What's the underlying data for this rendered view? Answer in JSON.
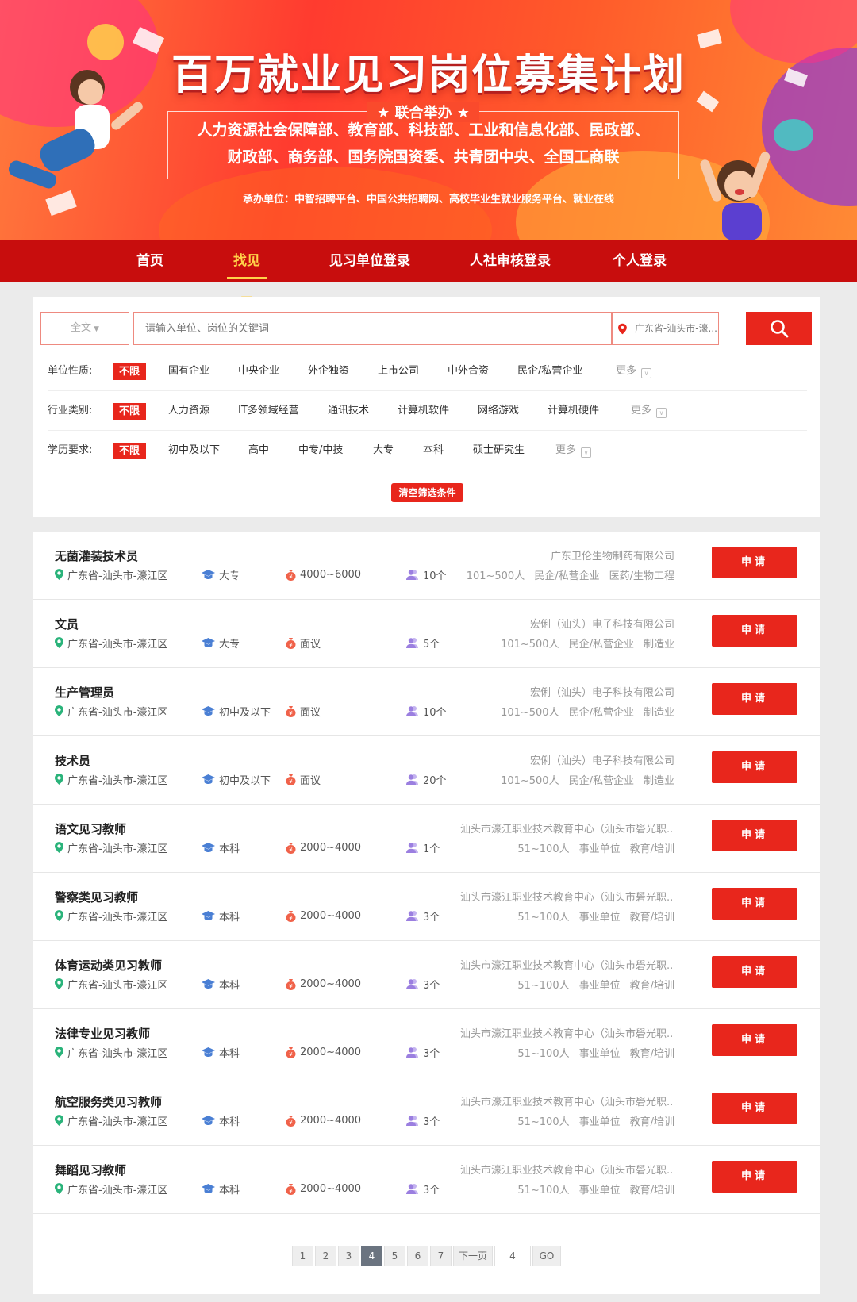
{
  "banner": {
    "title": "百万就业见习岗位募集计划",
    "joint_label": "★ 联合举办 ★",
    "orgs_line1": "人力资源社会保障部、教育部、科技部、工业和信息化部、民政部、",
    "orgs_line2": "财政部、商务部、国务院国资委、共青团中央、全国工商联",
    "undertake": "承办单位：中智招聘平台、中国公共招聘网、高校毕业生就业服务平台、就业在线"
  },
  "nav": {
    "items": [
      {
        "label": "首页",
        "active": false
      },
      {
        "label": "找见习",
        "active": true
      },
      {
        "label": "见习单位登录",
        "active": false
      },
      {
        "label": "人社审核登录",
        "active": false
      },
      {
        "label": "个人登录",
        "active": false
      }
    ]
  },
  "search": {
    "scope_label": "全文",
    "keyword_placeholder": "请输入单位、岗位的关键词",
    "location_value": "广东省-汕头市-濠..."
  },
  "filters": {
    "rows": [
      {
        "label": "单位性质:",
        "options": [
          "不限",
          "国有企业",
          "中央企业",
          "外企独资",
          "上市公司",
          "中外合资",
          "民企/私营企业"
        ],
        "selected": "不限",
        "more": "更多"
      },
      {
        "label": "行业类别:",
        "options": [
          "不限",
          "人力资源",
          "IT多领域经营",
          "通讯技术",
          "计算机软件",
          "网络游戏",
          "计算机硬件"
        ],
        "selected": "不限",
        "more": "更多"
      },
      {
        "label": "学历要求:",
        "options": [
          "不限",
          "初中及以下",
          "高中",
          "中专/中技",
          "大专",
          "本科",
          "硕士研究生"
        ],
        "selected": "不限",
        "more": "更多"
      }
    ],
    "clear_label": "清空筛选条件"
  },
  "jobs": [
    {
      "title": "无菌灌装技术员",
      "location": "广东省-汕头市-濠江区",
      "education": "大专",
      "salary": "4000~6000",
      "headcount": "10个",
      "company": "广东卫伦生物制药有限公司",
      "size": "101~500人",
      "nature": "民企/私营企业",
      "industry": "医药/生物工程",
      "apply": "申请"
    },
    {
      "title": "文员",
      "location": "广东省-汕头市-濠江区",
      "education": "大专",
      "salary": "面议",
      "headcount": "5个",
      "company": "宏俐（汕头）电子科技有限公司",
      "size": "101~500人",
      "nature": "民企/私营企业",
      "industry": "制造业",
      "apply": "申请"
    },
    {
      "title": "生产管理员",
      "location": "广东省-汕头市-濠江区",
      "education": "初中及以下",
      "salary": "面议",
      "headcount": "10个",
      "company": "宏俐（汕头）电子科技有限公司",
      "size": "101~500人",
      "nature": "民企/私营企业",
      "industry": "制造业",
      "apply": "申请"
    },
    {
      "title": "技术员",
      "location": "广东省-汕头市-濠江区",
      "education": "初中及以下",
      "salary": "面议",
      "headcount": "20个",
      "company": "宏俐（汕头）电子科技有限公司",
      "size": "101~500人",
      "nature": "民企/私营企业",
      "industry": "制造业",
      "apply": "申请"
    },
    {
      "title": "语文见习教师",
      "location": "广东省-汕头市-濠江区",
      "education": "本科",
      "salary": "2000~4000",
      "headcount": "1个",
      "company": "汕头市濠江职业技术教育中心（汕头市礐光职...",
      "size": "51~100人",
      "nature": "事业单位",
      "industry": "教育/培训",
      "apply": "申请"
    },
    {
      "title": "警察类见习教师",
      "location": "广东省-汕头市-濠江区",
      "education": "本科",
      "salary": "2000~4000",
      "headcount": "3个",
      "company": "汕头市濠江职业技术教育中心（汕头市礐光职...",
      "size": "51~100人",
      "nature": "事业单位",
      "industry": "教育/培训",
      "apply": "申请"
    },
    {
      "title": "体育运动类见习教师",
      "location": "广东省-汕头市-濠江区",
      "education": "本科",
      "salary": "2000~4000",
      "headcount": "3个",
      "company": "汕头市濠江职业技术教育中心（汕头市礐光职...",
      "size": "51~100人",
      "nature": "事业单位",
      "industry": "教育/培训",
      "apply": "申请"
    },
    {
      "title": "法律专业见习教师",
      "location": "广东省-汕头市-濠江区",
      "education": "本科",
      "salary": "2000~4000",
      "headcount": "3个",
      "company": "汕头市濠江职业技术教育中心（汕头市礐光职...",
      "size": "51~100人",
      "nature": "事业单位",
      "industry": "教育/培训",
      "apply": "申请"
    },
    {
      "title": "航空服务类见习教师",
      "location": "广东省-汕头市-濠江区",
      "education": "本科",
      "salary": "2000~4000",
      "headcount": "3个",
      "company": "汕头市濠江职业技术教育中心（汕头市礐光职...",
      "size": "51~100人",
      "nature": "事业单位",
      "industry": "教育/培训",
      "apply": "申请"
    },
    {
      "title": "舞蹈见习教师",
      "location": "广东省-汕头市-濠江区",
      "education": "本科",
      "salary": "2000~4000",
      "headcount": "3个",
      "company": "汕头市濠江职业技术教育中心（汕头市礐光职...",
      "size": "51~100人",
      "nature": "事业单位",
      "industry": "教育/培训",
      "apply": "申请"
    }
  ],
  "pagination": {
    "pages": [
      "1",
      "2",
      "3",
      "4",
      "5",
      "6",
      "7"
    ],
    "current": "4",
    "next_label": "下一页",
    "jump_value": "4",
    "go_label": "GO"
  },
  "colors": {
    "primary_red": "#e8261c",
    "nav_red": "#c80d0d",
    "nav_active": "#ffd24a",
    "location_icon": "#2ab37a",
    "education_icon": "#4a7fd4",
    "salary_icon": "#f0624a",
    "headcount_icon": "#9b7fe0"
  }
}
